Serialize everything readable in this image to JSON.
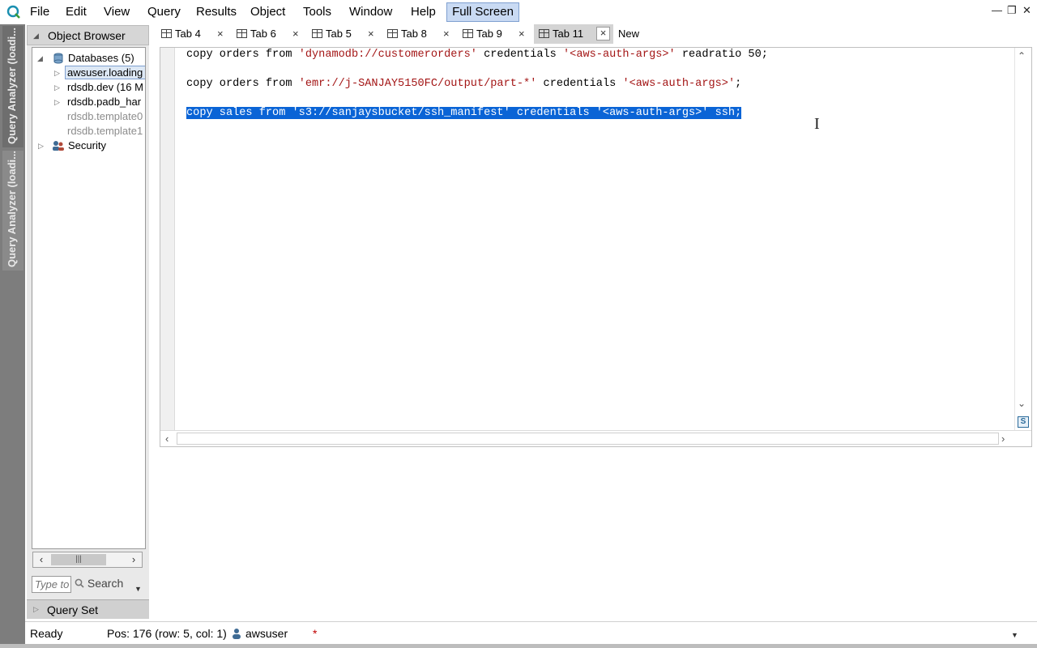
{
  "menubar": {
    "items": [
      "File",
      "Edit",
      "View",
      "Query",
      "Results",
      "Object",
      "Tools",
      "Window",
      "Help"
    ],
    "fullscreen_label": "Full Screen"
  },
  "side_tabs": [
    "Query Analyzer (loadi...",
    "Query Analyzer (loadi..."
  ],
  "object_browser": {
    "title": "Object Browser",
    "tree": [
      {
        "label": "Databases (5)"
      },
      {
        "label": "awsuser.loading"
      },
      {
        "label": "rdsdb.dev (16 M"
      },
      {
        "label": "rdsdb.padb_har"
      },
      {
        "label": "rdsdb.template0"
      },
      {
        "label": "rdsdb.template1"
      },
      {
        "label": "Security"
      }
    ],
    "search_placeholder": "Type to",
    "search_label": "Search",
    "query_set_label": "Query Set"
  },
  "tabs": [
    {
      "label": "Tab 4"
    },
    {
      "label": "Tab 6"
    },
    {
      "label": "Tab 5"
    },
    {
      "label": "Tab 8"
    },
    {
      "label": "Tab 9"
    },
    {
      "label": "Tab 11"
    }
  ],
  "new_tab_label": "New",
  "editor": {
    "line1": {
      "a": "copy orders from ",
      "s1": "'dynamodb://customerorders'",
      "b": " credentials ",
      "s2": "'<aws-auth-args>'",
      "c": " readratio 50;"
    },
    "line2": {
      "a": "copy orders from ",
      "s1": "'emr://j-SANJAY5150FC/output/part-*'",
      "b": " credentials ",
      "s2": "'<aws-auth-args>'",
      "c": ";"
    },
    "line3": "copy sales from 's3://sanjaysbucket/ssh_manifest' credentials '<aws-auth-args>' ssh;"
  },
  "status": {
    "state": "Ready",
    "position": "Pos: 176 (row: 5, col: 1)",
    "user": "awsuser",
    "modified": "*"
  },
  "colors": {
    "selection": "#0a64d6",
    "string": "#a31515",
    "accent": "#c9daf3"
  }
}
